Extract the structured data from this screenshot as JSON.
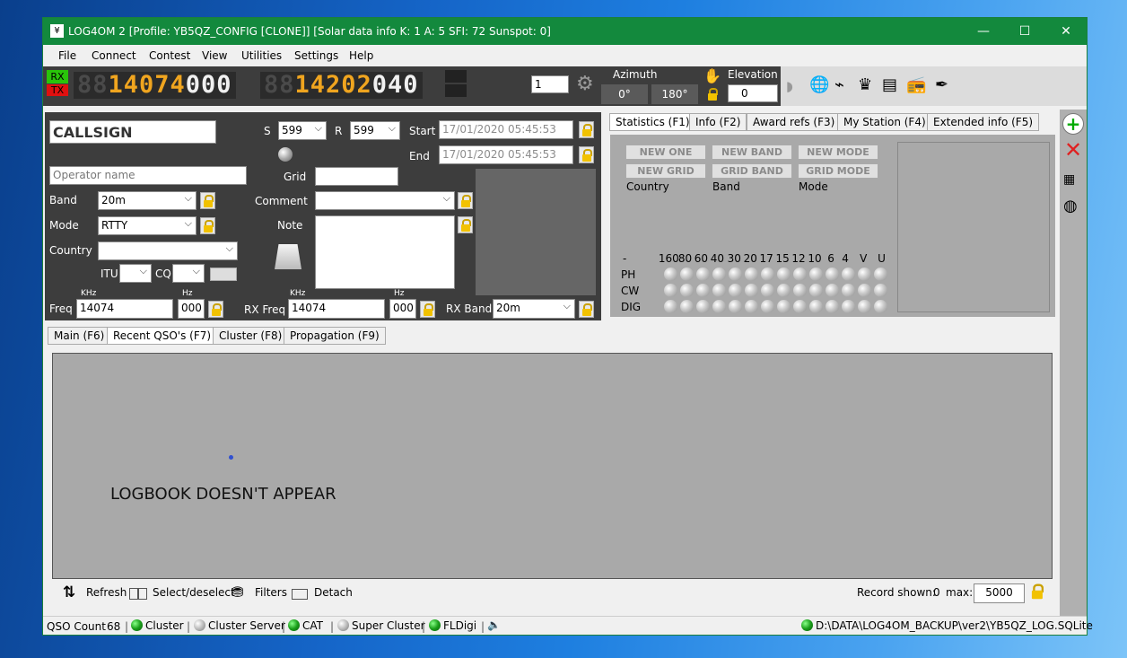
{
  "window": {
    "title": "LOG4OM 2 [Profile: YB5QZ_CONFIG [CLONE]] [Solar data info K: 1 A: 5 SFI: 72 Sunspot: 0]",
    "minimize": "—",
    "maximize": "☐",
    "close": "✕"
  },
  "menu": [
    "File",
    "Connect",
    "Contest",
    "View",
    "Utilities",
    "Settings",
    "Help"
  ],
  "radio": {
    "rx": "RX",
    "tx": "TX",
    "freq_rx_dim": "88",
    "freq_rx_on": "14074",
    "freq_rx_dec": "000",
    "freq_tx_dim": "88",
    "freq_tx_on": "14202",
    "freq_tx_dec": "040",
    "vfo": "1",
    "azimuth_label": "Azimuth",
    "az_0": "0°",
    "az_180": "180°",
    "elevation_label": "Elevation",
    "elevation_value": "0"
  },
  "qso": {
    "callsign_placeholder": "CALLSIGN",
    "operator_placeholder": "Operator name",
    "s_label": "S",
    "s_value": "599",
    "r_label": "R",
    "r_value": "599",
    "start_label": "Start",
    "start_value": "17/01/2020 05:45:53",
    "end_label": "End",
    "end_value": "17/01/2020 05:45:53",
    "grid_label": "Grid",
    "band_label": "Band",
    "band_value": "20m",
    "comment_label": "Comment",
    "mode_label": "Mode",
    "mode_value": "RTTY",
    "note_label": "Note",
    "country_label": "Country",
    "itu_label": "ITU",
    "cq_label": "CQ",
    "khz": "KHz",
    "hz": "Hz",
    "freq_label": "Freq",
    "freq_value": "14074",
    "freq_hz": "000",
    "rxfreq_label": "RX Freq",
    "rxfreq_value": "14074",
    "rxfreq_hz": "000",
    "rxband_label": "RX Band",
    "rxband_value": "20m"
  },
  "stats": {
    "tabs": [
      "Statistics (F1)",
      "Info (F2)",
      "Award refs (F3)",
      "My Station (F4)",
      "Extended info (F5)"
    ],
    "buttons": [
      "NEW ONE",
      "NEW BAND",
      "NEW MODE",
      "NEW GRID",
      "GRID BAND",
      "GRID MODE"
    ],
    "cols": [
      "Country",
      "Band",
      "Mode"
    ],
    "bands": [
      "-",
      "160",
      "80",
      "60",
      "40",
      "30",
      "20",
      "17",
      "15",
      "12",
      "10",
      "6",
      "4",
      "V",
      "U"
    ],
    "modes": [
      "PH",
      "CW",
      "DIG"
    ]
  },
  "lower_tabs": [
    "Main (F6)",
    "Recent QSO's (F7)",
    "Cluster (F8)",
    "Propagation (F9)"
  ],
  "logbook": {
    "message": "LOGBOOK DOESN'T APPEAR"
  },
  "toolbar": {
    "refresh": "Refresh",
    "select": "Select/deselect",
    "filters": "Filters",
    "detach": "Detach",
    "record_shown": "Record shown:",
    "record_count": "0",
    "max_label": "max:",
    "max_value": "5000"
  },
  "status": {
    "qso_count_label": "QSO Count",
    "qso_count": "68",
    "cluster": "Cluster",
    "cluster_server": "Cluster Server",
    "cat": "CAT",
    "super_cluster": "Super Cluster",
    "fldigi": "FLDigi",
    "db_path": "D:\\DATA\\LOG4OM_BACKUP\\ver2\\YB5QZ_LOG.SQLite"
  }
}
